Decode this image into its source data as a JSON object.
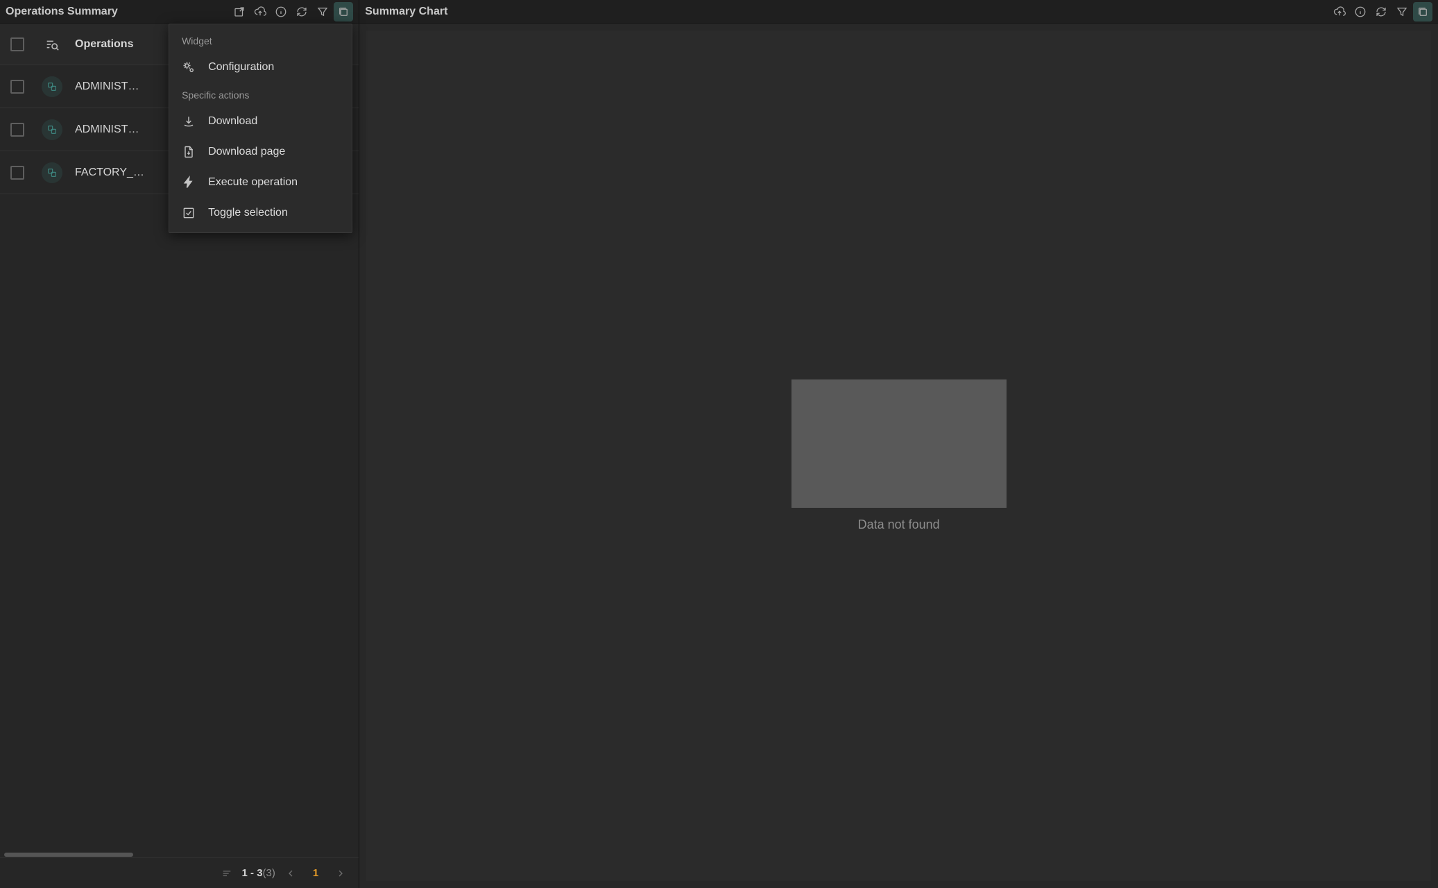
{
  "left_panel": {
    "title": "Operations Summary",
    "column_header": "Operations",
    "rows": [
      {
        "name": "ADMINIST…"
      },
      {
        "name": "ADMINIST…"
      },
      {
        "name": "FACTORY_…"
      }
    ],
    "pagination": {
      "range": "1 - 3",
      "total": "(3)",
      "current_page": "1"
    }
  },
  "right_panel": {
    "title": "Summary Chart",
    "empty_message": "Data not found"
  },
  "context_menu": {
    "section_widget": "Widget",
    "item_configuration": "Configuration",
    "section_specific": "Specific actions",
    "item_download": "Download",
    "item_download_page": "Download page",
    "item_execute": "Execute operation",
    "item_toggle_selection": "Toggle selection"
  }
}
